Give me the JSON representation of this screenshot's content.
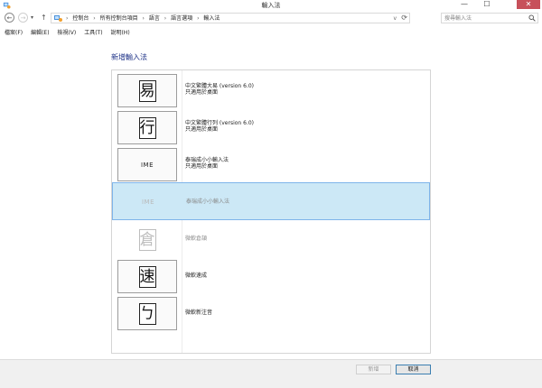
{
  "window": {
    "title": "輸入法",
    "minimize": "—",
    "maximize": "☐",
    "close": "✕"
  },
  "address": {
    "back": "←",
    "forward": "→",
    "dropdown": "▾",
    "up": "↑",
    "breadcrumb": [
      "控制台",
      "所有控制台項目",
      "語言",
      "語言選項",
      "輸入法"
    ],
    "separator": "›",
    "chevron": "v",
    "refresh": "⟳"
  },
  "search": {
    "placeholder": "搜尋輸入法"
  },
  "menu": [
    "檔案(F)",
    "編輯(E)",
    "檢視(V)",
    "工具(T)",
    "說明(H)"
  ],
  "page": {
    "heading": "新增輸入法"
  },
  "ime_list": [
    {
      "glyph": "易",
      "kind": "char",
      "line1": "中文繁體大易 (version 6.0)",
      "line2": "只適用於桌面",
      "state": "normal"
    },
    {
      "glyph": "行",
      "kind": "char",
      "line1": "中文繁體行列 (version 6.0)",
      "line2": "只適用於桌面",
      "state": "normal"
    },
    {
      "glyph": "IME",
      "kind": "text",
      "line1": "泰瑞成小小輸入法",
      "line2": "只適用於桌面",
      "state": "normal"
    },
    {
      "glyph": "IME",
      "kind": "text",
      "line1": "泰瑞成小小輸入法",
      "line2": "",
      "state": "selected"
    },
    {
      "glyph": "倉",
      "kind": "char",
      "line1": "微軟倉頡",
      "line2": "",
      "state": "disabled"
    },
    {
      "glyph": "速",
      "kind": "char",
      "line1": "微軟速成",
      "line2": "",
      "state": "normal"
    },
    {
      "glyph": "ㄅ",
      "kind": "char",
      "line1": "微軟新注音",
      "line2": "",
      "state": "normal"
    }
  ],
  "buttons": {
    "add": "新增",
    "cancel": "取消"
  },
  "colors": {
    "heading": "#1e3287",
    "selection_bg": "#cce8f6",
    "selection_border": "#7eb4ea",
    "close_button": "#c7505a"
  }
}
